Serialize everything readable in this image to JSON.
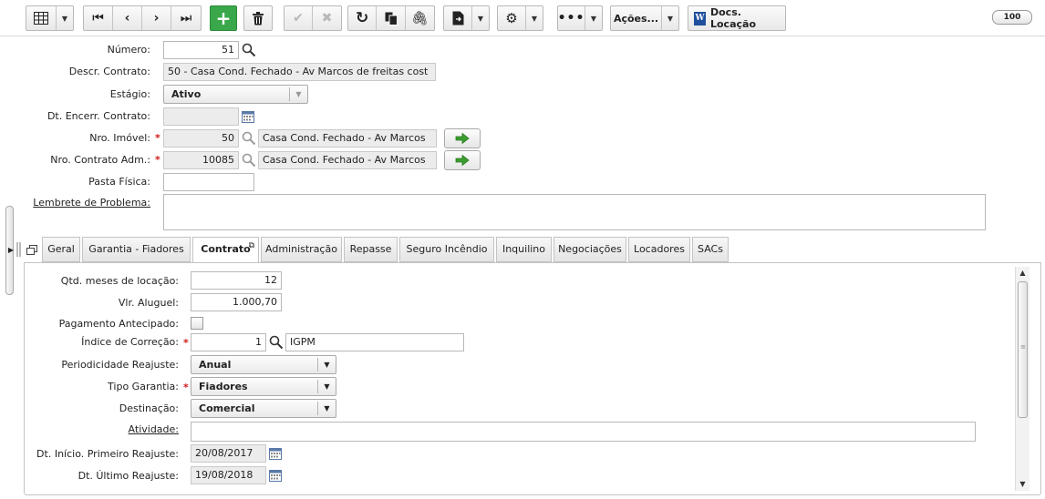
{
  "toolbar": {
    "acoes_label": "Ações...",
    "docs_label": "Docs. Locação",
    "word_letter": "W",
    "record_count": "100"
  },
  "form": {
    "numero": {
      "label": "Número:",
      "value": "51"
    },
    "descr_contrato": {
      "label": "Descr. Contrato:",
      "value": "50 - Casa Cond. Fechado - Av Marcos de freitas cost"
    },
    "estagio": {
      "label": "Estágio:",
      "value": "Ativo"
    },
    "dt_encerr": {
      "label": "Dt. Encerr. Contrato:",
      "value": ""
    },
    "nro_imovel": {
      "label": "Nro. Imóvel:",
      "value": "50",
      "description": "Casa Cond. Fechado - Av Marcos"
    },
    "nro_contrato_adm": {
      "label": "Nro. Contrato Adm.:",
      "value": "10085",
      "description": "Casa Cond. Fechado - Av Marcos"
    },
    "pasta_fisica": {
      "label": "Pasta Física:",
      "value": ""
    },
    "lembrete": {
      "label": "Lembrete de Problema:",
      "value": ""
    },
    "required_mark": "*"
  },
  "tabs": [
    {
      "label": "Geral"
    },
    {
      "label": "Garantia - Fiadores"
    },
    {
      "label": "Contrato"
    },
    {
      "label": "Administração"
    },
    {
      "label": "Repasse"
    },
    {
      "label": "Seguro Incêndio"
    },
    {
      "label": "Inquilino"
    },
    {
      "label": "Negociações"
    },
    {
      "label": "Locadores"
    },
    {
      "label": "SACs"
    }
  ],
  "contrato_tab": {
    "qtd_meses": {
      "label": "Qtd. meses de locação:",
      "value": "12"
    },
    "vlr_aluguel": {
      "label": "Vlr. Aluguel:",
      "value": "1.000,70"
    },
    "pagamento_antecipado": {
      "label": "Pagamento Antecipado:",
      "checked": false
    },
    "indice_correcao": {
      "label": "Índice de Correção:",
      "value": "1",
      "description": "IGPM"
    },
    "periodicidade": {
      "label": "Periodicidade Reajuste:",
      "value": "Anual"
    },
    "tipo_garantia": {
      "label": "Tipo Garantia:",
      "value": "Fiadores"
    },
    "destinacao": {
      "label": "Destinação:",
      "value": "Comercial"
    },
    "atividade": {
      "label": "Atividade:",
      "value": ""
    },
    "dt_inicio_reajuste": {
      "label": "Dt. Início. Primeiro Reajuste:",
      "value": "20/08/2017"
    },
    "dt_ultimo_reajuste": {
      "label": "Dt. Último Reajuste:",
      "value": "19/08/2018"
    }
  },
  "colors": {
    "accent_green": "#3aa84a",
    "required_red": "#d01818",
    "arrow_green": "#3b9e2f"
  }
}
